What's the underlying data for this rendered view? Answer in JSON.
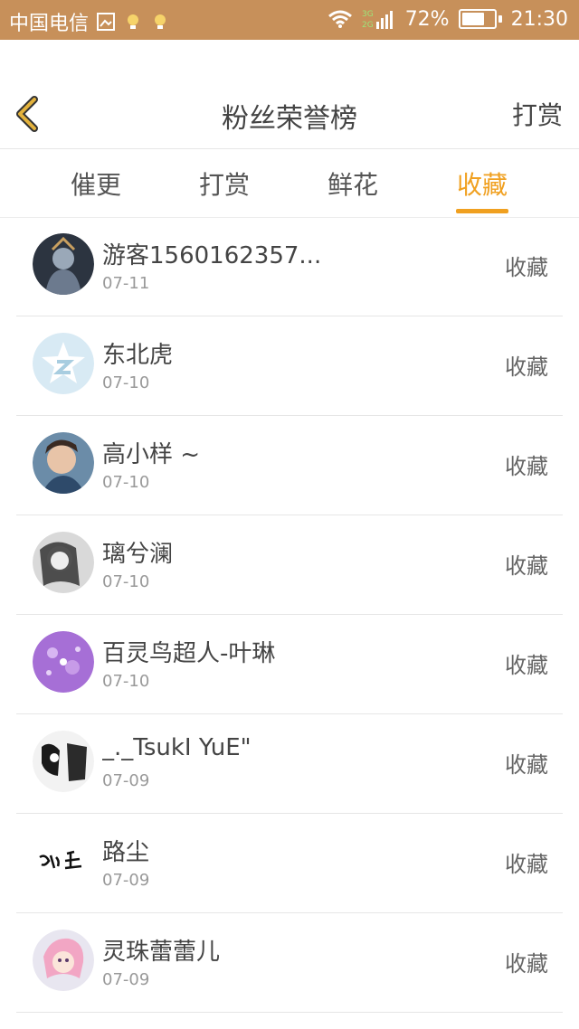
{
  "status": {
    "carrier": "中国电信",
    "battery": "72%",
    "battery_level": 0.72,
    "time": "21:30",
    "network": "3G 2G"
  },
  "header": {
    "title": "粉丝荣誉榜",
    "action": "打赏"
  },
  "tabs": [
    {
      "label": "催更"
    },
    {
      "label": "打赏"
    },
    {
      "label": "鲜花"
    },
    {
      "label": "收藏",
      "active": true
    }
  ],
  "rows": [
    {
      "name": "游客1560162357...",
      "date": "07-11",
      "action": "收藏",
      "avatar": "warrior-avatar"
    },
    {
      "name": "东北虎",
      "date": "07-10",
      "action": "收藏",
      "avatar": "qzone-star-avatar"
    },
    {
      "name": "高小样 ~",
      "date": "07-10",
      "action": "收藏",
      "avatar": "portrait-avatar"
    },
    {
      "name": "璃兮澜",
      "date": "07-10",
      "action": "收藏",
      "avatar": "bw-photo-avatar"
    },
    {
      "name": "百灵鸟超人-叶琳",
      "date": "07-10",
      "action": "收藏",
      "avatar": "purple-avatar"
    },
    {
      "name": "_._TsukI YuE\"",
      "date": "07-09",
      "action": "收藏",
      "avatar": "comic-avatar"
    },
    {
      "name": "路尘",
      "date": "07-09",
      "action": "收藏",
      "avatar": "calligraphy-avatar"
    },
    {
      "name": "灵珠蕾蕾儿",
      "date": "07-09",
      "action": "收藏",
      "avatar": "anime-avatar"
    }
  ],
  "colors": {
    "statusbar": "#c7905a",
    "accent": "#f0a020",
    "back_icon": "#e3b23c"
  }
}
